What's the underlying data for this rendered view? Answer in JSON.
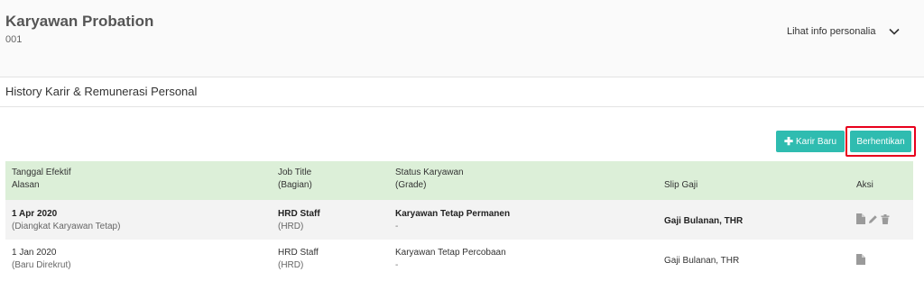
{
  "header": {
    "employee_name": "Karyawan Probation",
    "employee_id": "001",
    "info_toggle_label": "Lihat info personalia"
  },
  "section": {
    "title": "History Karir & Remunerasi Personal"
  },
  "toolbar": {
    "new_career_label": "Karir Baru",
    "stop_label": "Berhentikan",
    "accent_color": "#2fbcb0",
    "highlight_color": "#e8001c"
  },
  "table": {
    "columns": [
      {
        "line1": "Tanggal Efektif",
        "line2": "Alasan"
      },
      {
        "line1": "Job Title",
        "line2": "(Bagian)"
      },
      {
        "line1": "Status Karyawan",
        "line2": "(Grade)"
      },
      {
        "line1": "Slip Gaji",
        "line2": ""
      },
      {
        "line1": "Aksi",
        "line2": ""
      }
    ],
    "header_color": "#dcefd8",
    "rows": [
      {
        "date": "1 Apr 2020",
        "reason": "(Diangkat Karyawan Tetap)",
        "job_title": "HRD Staff",
        "department": "(HRD)",
        "status": "Karyawan Tetap Permanen",
        "grade": "-",
        "slip": "Gaji Bulanan, THR",
        "actions": [
          "document-icon",
          "pencil-icon",
          "trash-icon"
        ]
      },
      {
        "date": "1 Jan 2020",
        "reason": "(Baru Direkrut)",
        "job_title": "HRD Staff",
        "department": "(HRD)",
        "status": "Karyawan Tetap Percobaan",
        "grade": "-",
        "slip": "Gaji Bulanan, THR",
        "actions": [
          "document-icon"
        ]
      }
    ]
  }
}
